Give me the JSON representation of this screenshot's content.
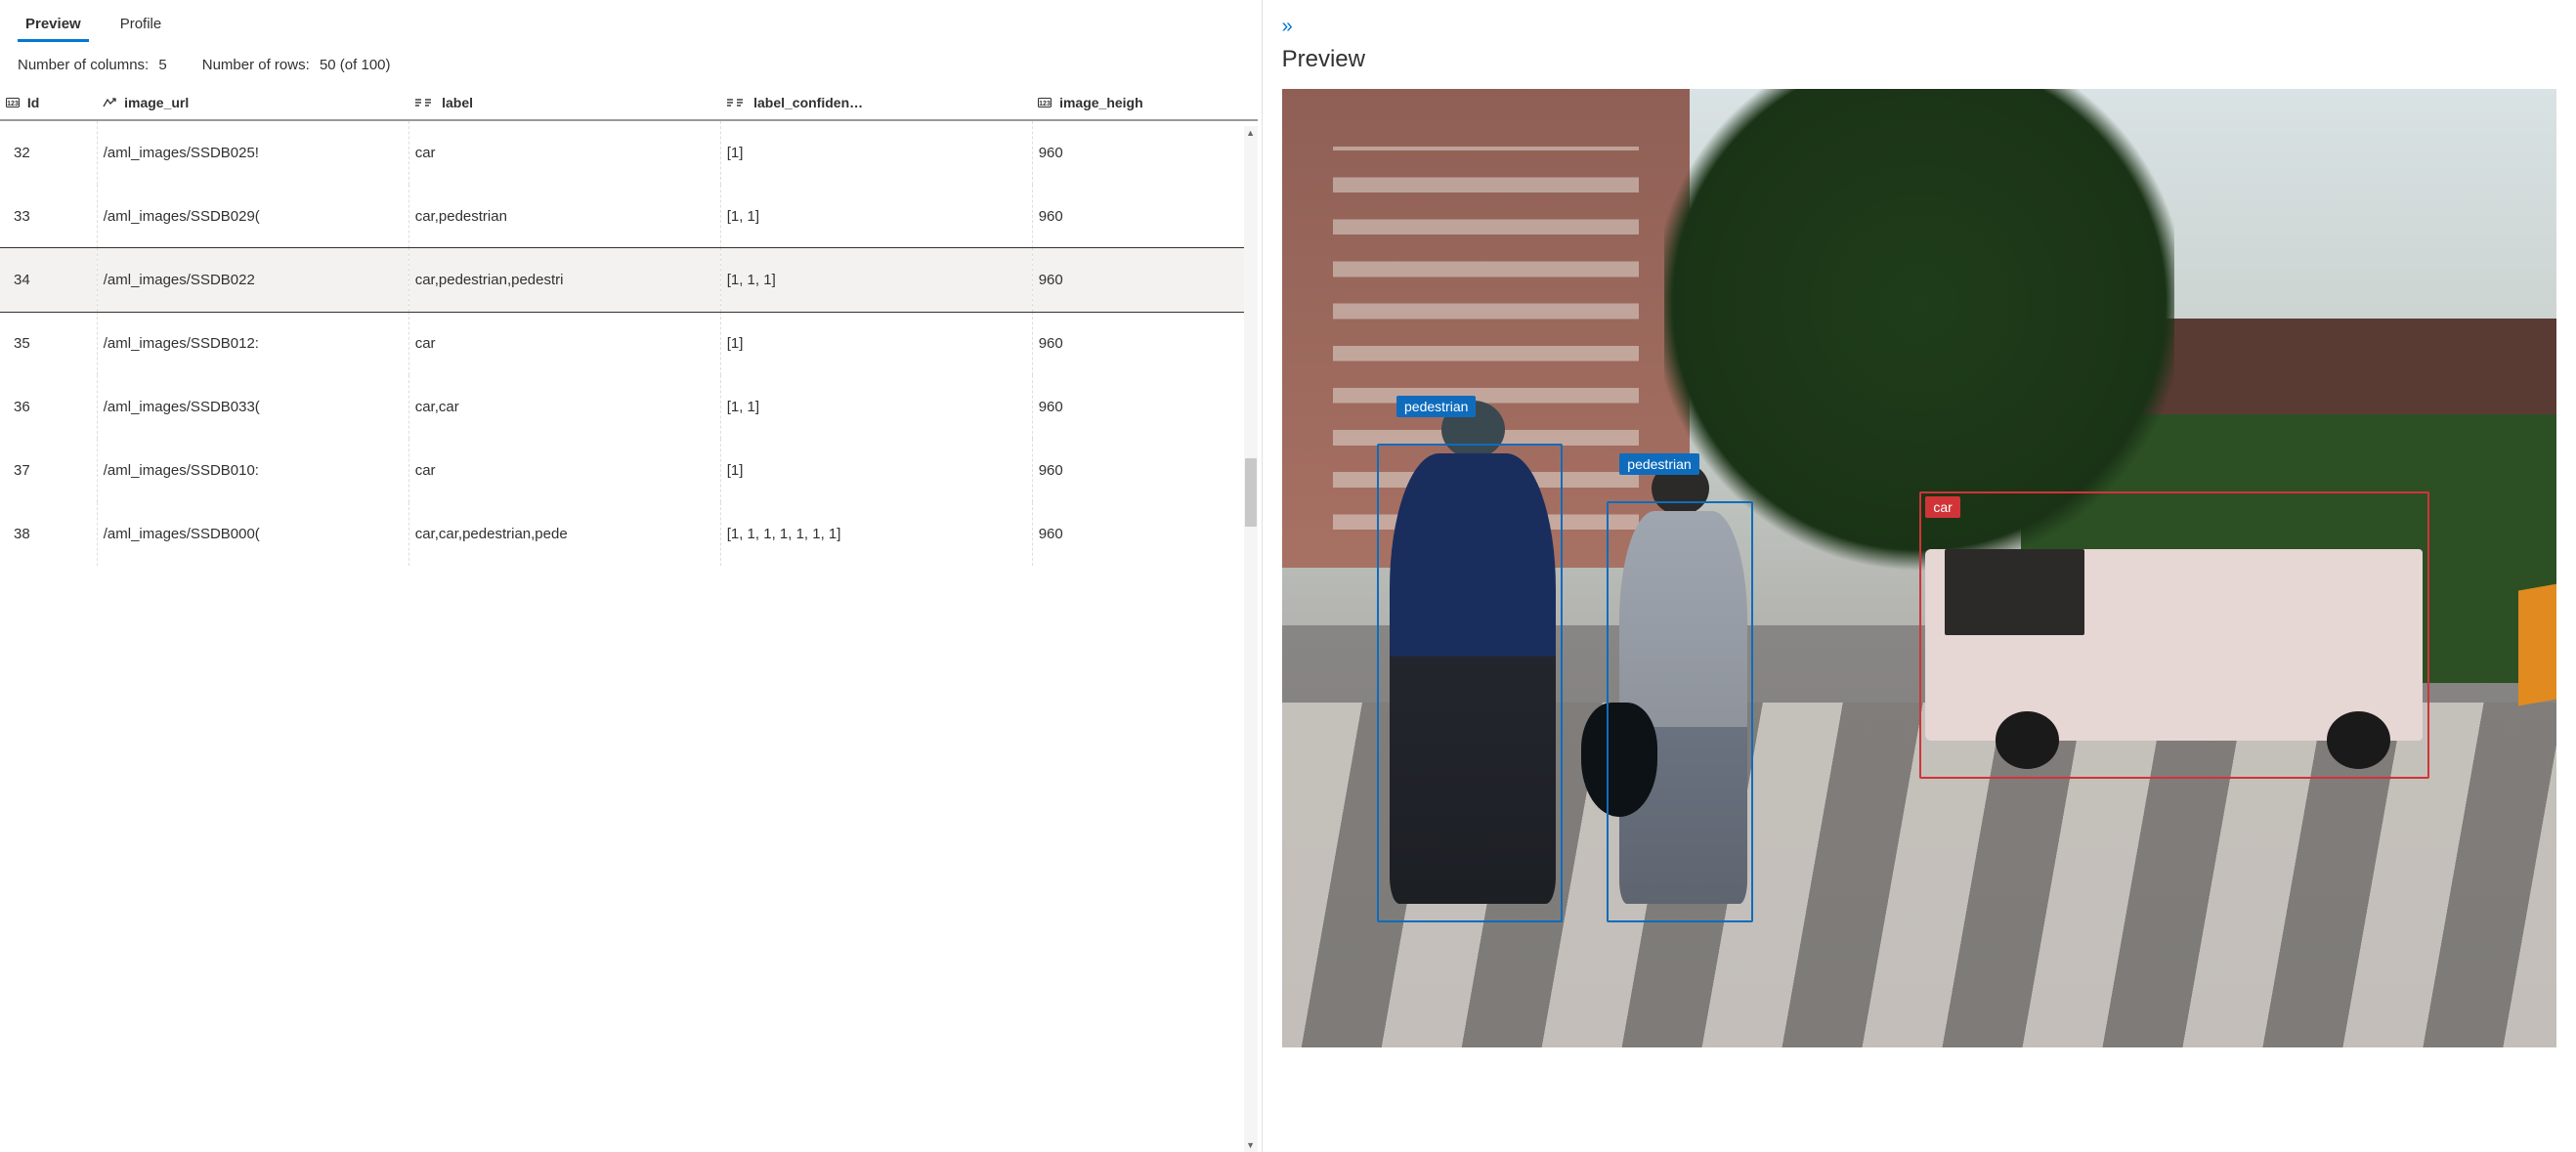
{
  "tabs": {
    "preview": "Preview",
    "profile": "Profile"
  },
  "stats": {
    "columns_label": "Number of columns:",
    "columns_value": "5",
    "rows_label": "Number of rows:",
    "rows_value": "50 (of 100)"
  },
  "columns": {
    "id": "Id",
    "image_url": "image_url",
    "label": "label",
    "label_confidence": "label_confiden…",
    "image_height": "image_heigh"
  },
  "rows": [
    {
      "id": "32",
      "image_url": "/aml_images/SSDB025!",
      "label": "car",
      "conf": "[1]",
      "height": "960",
      "selected": false
    },
    {
      "id": "33",
      "image_url": "/aml_images/SSDB029(",
      "label": "car,pedestrian",
      "conf": "[1, 1]",
      "height": "960",
      "selected": false
    },
    {
      "id": "34",
      "image_url": "/aml_images/SSDB022",
      "label": "car,pedestrian,pedestri",
      "conf": "[1, 1, 1]",
      "height": "960",
      "selected": true
    },
    {
      "id": "35",
      "image_url": "/aml_images/SSDB012:",
      "label": "car",
      "conf": "[1]",
      "height": "960",
      "selected": false
    },
    {
      "id": "36",
      "image_url": "/aml_images/SSDB033(",
      "label": "car,car",
      "conf": "[1, 1]",
      "height": "960",
      "selected": false
    },
    {
      "id": "37",
      "image_url": "/aml_images/SSDB010:",
      "label": "car",
      "conf": "[1]",
      "height": "960",
      "selected": false
    },
    {
      "id": "38",
      "image_url": "/aml_images/SSDB000(",
      "label": "car,car,pedestrian,pede",
      "conf": "[1, 1, 1, 1, 1, 1, 1]",
      "height": "960",
      "selected": false
    }
  ],
  "right": {
    "collapse_glyph": "»",
    "title": "Preview"
  },
  "annotations": {
    "pedestrian": "pedestrian",
    "car": "car"
  }
}
